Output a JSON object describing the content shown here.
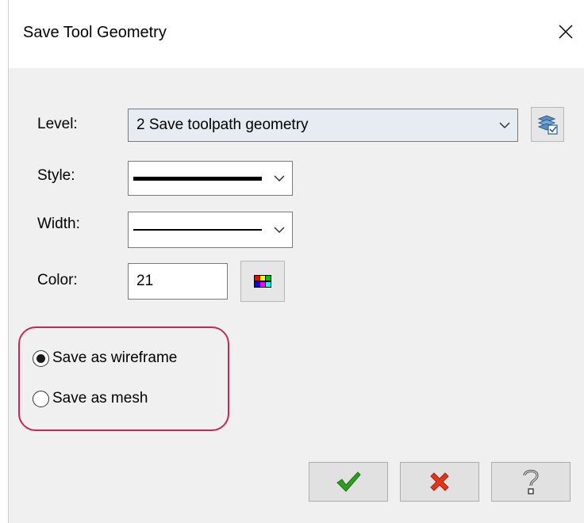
{
  "dialog": {
    "title": "Save Tool Geometry"
  },
  "form": {
    "level_label": "Level:",
    "level_value": "2 Save toolpath geometry",
    "style_label": "Style:",
    "width_label": "Width:",
    "color_label": "Color:",
    "color_value": "21"
  },
  "options": {
    "wireframe_label": "Save as wireframe",
    "mesh_label": "Save as mesh",
    "selected": "wireframe"
  },
  "icons": {
    "close": "close-icon",
    "level_manager": "layers-icon",
    "color_picker": "color-grid-icon",
    "ok": "checkmark-icon",
    "cancel": "x-mark-icon",
    "help": "question-mark-icon"
  },
  "colors": {
    "highlight": "#c2285a",
    "ok": "#2e9e1e",
    "cancel": "#e0361c"
  }
}
